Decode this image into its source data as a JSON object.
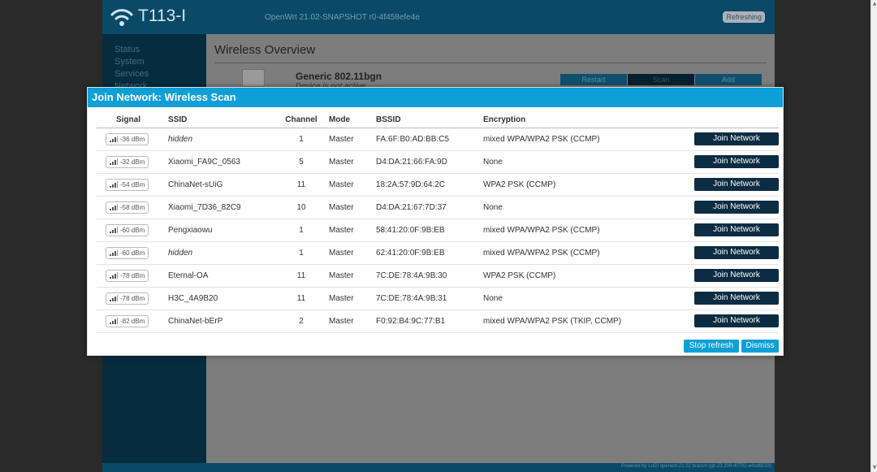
{
  "colors": {
    "accent": "#0e9fd6",
    "dark_button": "#0b2c43",
    "header_bar": "#0a4a68",
    "sidebar": "#062c40"
  },
  "header": {
    "brand": "T113-I",
    "release": "OpenWrt 21.02-SNAPSHOT r0-4f458efe4e",
    "status_badge": "Refreshing",
    "logo_icon": "wifi-logo-icon"
  },
  "sidebar": {
    "items": [
      {
        "label": "Status"
      },
      {
        "label": "System"
      },
      {
        "label": "Services"
      },
      {
        "label": "Network"
      }
    ]
  },
  "content": {
    "title": "Wireless Overview",
    "radio": {
      "name": "Generic 802.11bgn",
      "status": "Device is not active",
      "icon_label": "radio0"
    },
    "buttons": {
      "restart": "Restart",
      "scan": "Scan",
      "add": "Add"
    }
  },
  "footer": {
    "text": "Powered by LuCI openwrt-21.02 branch (git-23.208.40702-e4cd6533)"
  },
  "modal": {
    "title": "Join Network: Wireless Scan",
    "columns": {
      "signal": "Signal",
      "ssid": "SSID",
      "channel": "Channel",
      "mode": "Mode",
      "bssid": "BSSID",
      "encryption": "Encryption"
    },
    "rows": [
      {
        "signal": "-36 dBm",
        "ssid": "hidden",
        "channel": "1",
        "mode": "Master",
        "bssid": "FA:6F:B0:AD:BB:C5",
        "encryption": "mixed WPA/WPA2 PSK (CCMP)",
        "action": "Join Network"
      },
      {
        "signal": "-32 dBm",
        "ssid": "Xiaomi_FA9C_0563",
        "channel": "5",
        "mode": "Master",
        "bssid": "D4:DA:21:66:FA:9D",
        "encryption": "None",
        "action": "Join Network"
      },
      {
        "signal": "-54 dBm",
        "ssid": "ChinaNet-sUiG",
        "channel": "11",
        "mode": "Master",
        "bssid": "18:2A:57:9D:64:2C",
        "encryption": "WPA2 PSK (CCMP)",
        "action": "Join Network"
      },
      {
        "signal": "-58 dBm",
        "ssid": "Xiaomi_7D36_82C9",
        "channel": "10",
        "mode": "Master",
        "bssid": "D4:DA:21:67:7D:37",
        "encryption": "None",
        "action": "Join Network"
      },
      {
        "signal": "-60 dBm",
        "ssid": "Pengxiaowu",
        "channel": "1",
        "mode": "Master",
        "bssid": "58:41:20:0F:9B:EB",
        "encryption": "mixed WPA/WPA2 PSK (CCMP)",
        "action": "Join Network"
      },
      {
        "signal": "-60 dBm",
        "ssid": "hidden",
        "channel": "1",
        "mode": "Master",
        "bssid": "62:41:20:0F:9B:EB",
        "encryption": "mixed WPA/WPA2 PSK (CCMP)",
        "action": "Join Network"
      },
      {
        "signal": "-78 dBm",
        "ssid": "Eternal-OA",
        "channel": "11",
        "mode": "Master",
        "bssid": "7C:DE:78:4A:9B:30",
        "encryption": "WPA2 PSK (CCMP)",
        "action": "Join Network"
      },
      {
        "signal": "-78 dBm",
        "ssid": "H3C_4A9B20",
        "channel": "11",
        "mode": "Master",
        "bssid": "7C:DE:78:4A:9B:31",
        "encryption": "None",
        "action": "Join Network"
      },
      {
        "signal": "-82 dBm",
        "ssid": "ChinaNet-bErP",
        "channel": "2",
        "mode": "Master",
        "bssid": "F0:92:B4:9C:77:B1",
        "encryption": "mixed WPA/WPA2 PSK (TKIP, CCMP)",
        "action": "Join Network"
      }
    ],
    "stop_refresh": "Stop refresh",
    "dismiss": "Dismiss"
  }
}
